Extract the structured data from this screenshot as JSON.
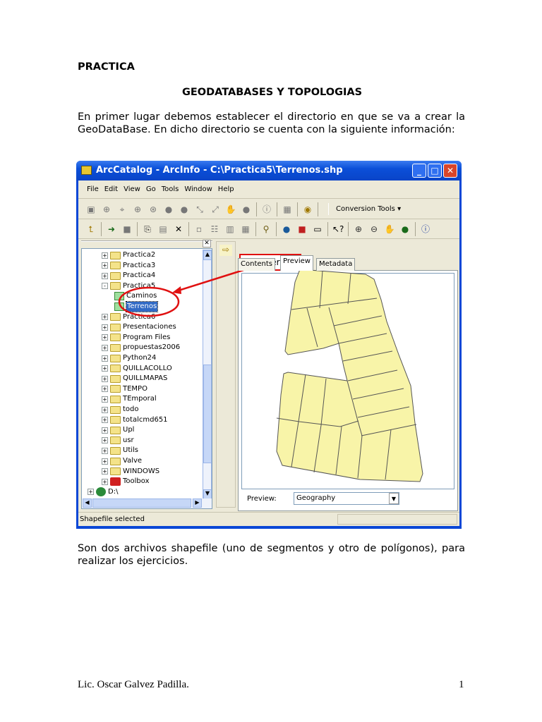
{
  "doc": {
    "heading": "PRACTICA",
    "subheading": "GEODATABASES Y TOPOLOGIAS",
    "para1": "En primer lugar debemos establecer el directorio en que se va a crear la GeoDataBase. En dicho directorio se cuenta con la siguiente información:",
    "para2": "Son dos archivos shapefile (uno de segmentos y otro de polígonos), para realizar los ejercicios.",
    "footer_author": "Lic. Oscar Galvez Padilla.",
    "page_number": "1"
  },
  "window": {
    "title": "ArcCatalog - ArcInfo - C:\\Practica5\\Terrenos.shp",
    "menu": [
      "File",
      "Edit",
      "View",
      "Go",
      "Tools",
      "Window",
      "Help"
    ],
    "conversion_tools": "Conversion Tools",
    "tree": [
      {
        "label": "Practica2",
        "level": 1,
        "exp": "+"
      },
      {
        "label": "Practica3",
        "level": 1,
        "exp": "+"
      },
      {
        "label": "Practica4",
        "level": 1,
        "exp": "+"
      },
      {
        "label": "Practica5",
        "level": 1,
        "exp": "-"
      },
      {
        "label": "Caminos",
        "level": 2,
        "type": "line"
      },
      {
        "label": "Terrenos",
        "level": 2,
        "type": "poly",
        "selected": true
      },
      {
        "label": "Practica6",
        "level": 1,
        "exp": "+"
      },
      {
        "label": "Presentaciones",
        "level": 1,
        "exp": "+"
      },
      {
        "label": "Program Files",
        "level": 1,
        "exp": "+"
      },
      {
        "label": "propuestas2006",
        "level": 1,
        "exp": "+"
      },
      {
        "label": "Python24",
        "level": 1,
        "exp": "+"
      },
      {
        "label": "QUILLACOLLO",
        "level": 1,
        "exp": "+"
      },
      {
        "label": "QUILLMAPAS",
        "level": 1,
        "exp": "+"
      },
      {
        "label": "TEMPO",
        "level": 1,
        "exp": "+"
      },
      {
        "label": "TEmporal",
        "level": 1,
        "exp": "+"
      },
      {
        "label": "todo",
        "level": 1,
        "exp": "+"
      },
      {
        "label": "totalcmd651",
        "level": 1,
        "exp": "+"
      },
      {
        "label": "Upl",
        "level": 1,
        "exp": "+"
      },
      {
        "label": "usr",
        "level": 1,
        "exp": "+"
      },
      {
        "label": "Utils",
        "level": 1,
        "exp": "+"
      },
      {
        "label": "Valve",
        "level": 1,
        "exp": "+"
      },
      {
        "label": "WINDOWS",
        "level": 1,
        "exp": "+"
      },
      {
        "label": "Toolbox",
        "level": 1,
        "exp": "+",
        "type": "toolbox"
      },
      {
        "label": "D:\\",
        "level": 0,
        "exp": "+",
        "type": "drive"
      }
    ],
    "tabs": [
      "Contents",
      "Preview",
      "Metadata"
    ],
    "active_tab": "Preview",
    "callout": "Layers",
    "preview_label": "Preview:",
    "preview_value": "Geography",
    "status": "Shapefile selected",
    "map_fill": "#f8f4a8"
  }
}
